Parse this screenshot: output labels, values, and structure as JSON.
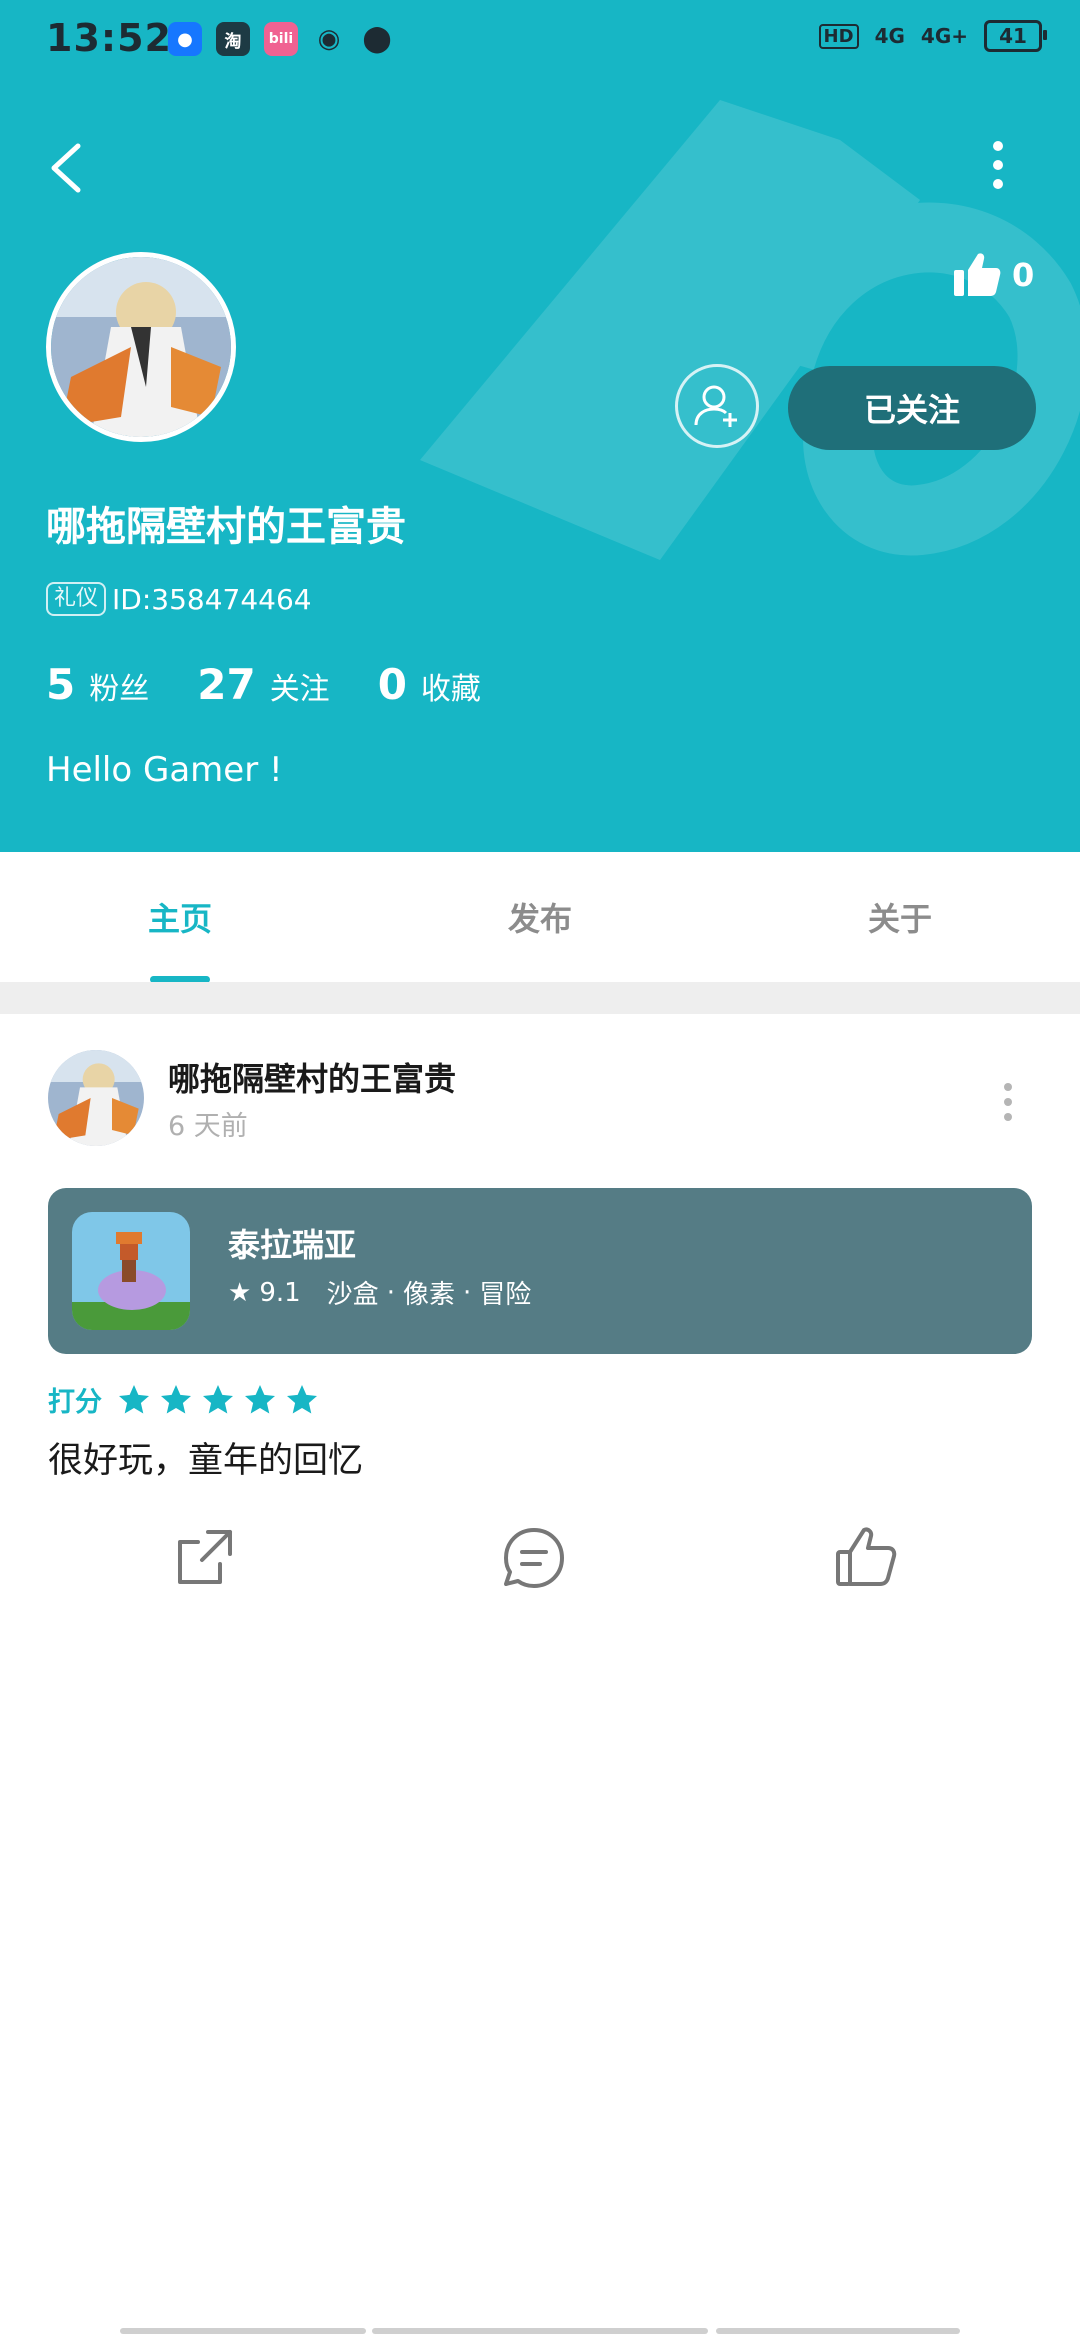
{
  "status_bar": {
    "time": "13:52",
    "apps": [
      "qq-icon",
      "taobao-icon",
      "bilibili-icon",
      "weibo-icon",
      "location-icon"
    ],
    "signal_1": "4G",
    "signal_2": "4G+",
    "battery": "41"
  },
  "profile": {
    "likes": "0",
    "username": "哪拖隔壁村的王富贵",
    "id_badge": "礼仪",
    "id_text": "ID:358474464",
    "stats": [
      {
        "value": "5",
        "label": "粉丝"
      },
      {
        "value": "27",
        "label": "关注"
      },
      {
        "value": "0",
        "label": "收藏"
      }
    ],
    "bio": "Hello Gamer !",
    "follow_label": "已关注"
  },
  "tabs": [
    {
      "label": "主页",
      "active": true
    },
    {
      "label": "发布",
      "active": false
    },
    {
      "label": "关于",
      "active": false
    }
  ],
  "post": {
    "author": "哪拖隔壁村的王富贵",
    "time": "6 天前",
    "game": {
      "name": "泰拉瑞亚",
      "score": "9.1",
      "tags": [
        "沙盒",
        "像素",
        "冒险"
      ]
    },
    "rating_label": "打分",
    "rating_stars": 5,
    "review": "很好玩，童年的回忆"
  },
  "colors": {
    "accent": "#17b6c5",
    "follow_button": "#1f6f79",
    "game_card": "#557c85"
  }
}
